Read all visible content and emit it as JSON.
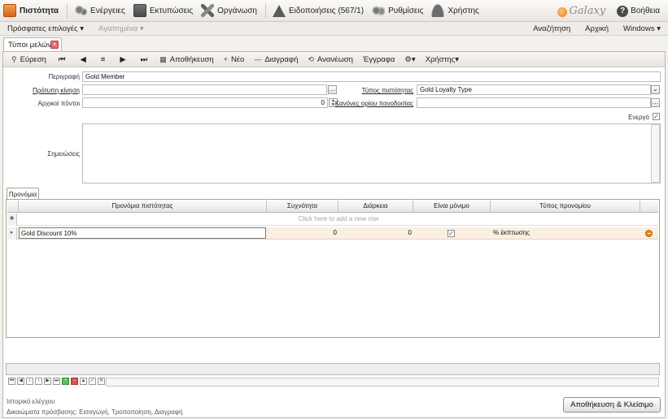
{
  "topmenu": {
    "items": [
      {
        "label": "Πιστότητα",
        "icon": "card-icon",
        "active": true
      },
      {
        "label": "Ενέργειες",
        "icon": "gears-icon"
      },
      {
        "label": "Εκτυπώσεις",
        "icon": "print-icon"
      },
      {
        "label": "Οργάνωση",
        "icon": "tools-icon"
      },
      {
        "label": "Ειδοποιήσεις (567/1)",
        "icon": "warning-icon"
      },
      {
        "label": "Ρυθμίσεις",
        "icon": "settings-icon"
      },
      {
        "label": "Χρήστης",
        "icon": "user-icon"
      }
    ],
    "logo": "Galaxy",
    "help_label": "Βοήθεια"
  },
  "secondmenu": {
    "recent": "Πρόσφατες επιλογές",
    "favorites": "Αγαπημένα",
    "search": "Αναζήτηση",
    "home": "Αρχική",
    "windows": "Windows"
  },
  "doc_tab": {
    "label": "Τύποι μελών"
  },
  "toolbar": {
    "search": "Εύρεση",
    "save": "Αποθήκευση",
    "new": "Νέο",
    "delete": "Διαγραφή",
    "refresh": "Ανανέωση",
    "documents": "Έγγραφα",
    "user": "Χρήστης"
  },
  "form": {
    "description_label": "Περιγραφή",
    "description_value": "Gold Member",
    "default_move_label": "Πρότυπη κίνηση",
    "default_move_value": "",
    "loyalty_type_label": "Τύπος πιστότητας",
    "loyalty_type_value": "Gold Loyalty Type",
    "initial_points_label": "Αρχικοί πόντοι",
    "initial_points_value": "0",
    "score_rule_label": "Κανόνες ορίου πονοδοσίας",
    "score_rule_value": "",
    "active_label": "Ενεργό",
    "active_checked": true,
    "notes_label": "Σημειώσεις",
    "notes_value": ""
  },
  "benefits": {
    "tab_label": "Προνόμια",
    "columns": [
      "Προνόμια πιστότητας",
      "Συχνότητα",
      "Διάρκεια",
      "Είναι μόνιμο",
      "Τύπος προνομίου"
    ],
    "new_row_hint": "Click here to add a new row",
    "rows": [
      {
        "benefit": "Gold Discount 10%",
        "frequency": "0",
        "duration": "0",
        "permanent": true,
        "type": "% έκπτωσης"
      }
    ]
  },
  "footer": {
    "audit": "Ιστορικό ελέγχου",
    "rights": "Δικαιώματα πρόσβασης: Εισαγωγή, Τροποποίηση, Διαγραφή",
    "save_close": "Αποθήκευση & Κλείσιμο"
  }
}
